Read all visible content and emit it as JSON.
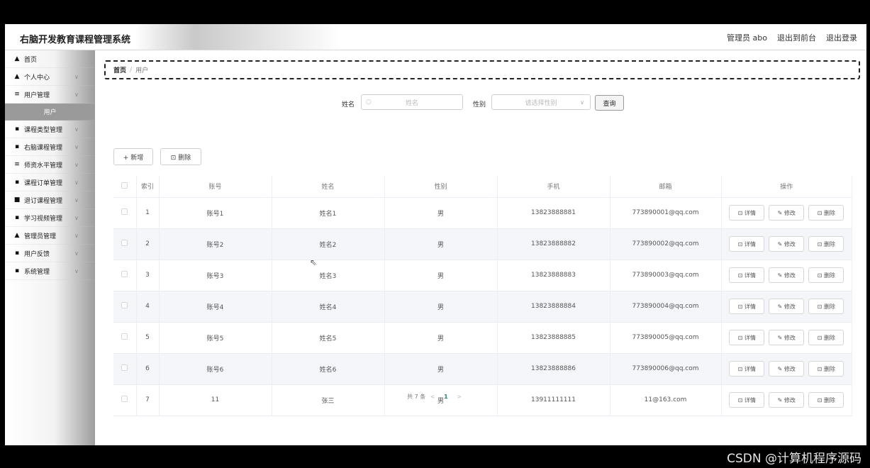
{
  "app": {
    "title": "右脑开发教育课程管理系统",
    "user_label": "管理员 abo",
    "to_front": "退出到前台",
    "logout": "退出登录"
  },
  "sidebar": {
    "items": [
      {
        "icon": "home-icon",
        "glyph": "▲",
        "label": "首页",
        "chevron": false
      },
      {
        "icon": "user-icon",
        "glyph": "▲",
        "label": "个人中心",
        "chevron": true
      },
      {
        "icon": "list-icon",
        "glyph": "≡",
        "label": "用户管理",
        "chevron": true
      },
      {
        "icon": "",
        "glyph": "",
        "label": "用户",
        "chevron": false,
        "sub": true
      },
      {
        "icon": "grid-icon",
        "glyph": "▪",
        "label": "课程类型管理",
        "chevron": true
      },
      {
        "icon": "grid-icon",
        "glyph": "▪",
        "label": "右脑课程管理",
        "chevron": true
      },
      {
        "icon": "sliders-icon",
        "glyph": "≡",
        "label": "师资水平管理",
        "chevron": true
      },
      {
        "icon": "grid-icon",
        "glyph": "▪",
        "label": "课程订单管理",
        "chevron": true
      },
      {
        "icon": "trash-icon",
        "glyph": "■",
        "label": "退订课程管理",
        "chevron": true
      },
      {
        "icon": "grid-icon",
        "glyph": "▪",
        "label": "学习视频管理",
        "chevron": true
      },
      {
        "icon": "admin-icon",
        "glyph": "▲",
        "label": "管理员管理",
        "chevron": true
      },
      {
        "icon": "grid-icon",
        "glyph": "▪",
        "label": "用户反馈",
        "chevron": true
      },
      {
        "icon": "grid-icon",
        "glyph": "▪",
        "label": "系统管理",
        "chevron": true
      }
    ]
  },
  "breadcrumb": {
    "home": "首页",
    "sep": "/",
    "current": "用户"
  },
  "search": {
    "name_label": "姓名",
    "name_placeholder": "姓名",
    "gender_label": "性别",
    "gender_placeholder": "请选择性别",
    "query_button": "查询"
  },
  "actions": {
    "add": "+ 新增",
    "delete": "⊡ 删除"
  },
  "table": {
    "headers": [
      "索引",
      "账号",
      "姓名",
      "性别",
      "手机",
      "邮箱",
      "操作"
    ],
    "rows": [
      {
        "idx": "1",
        "account": "账号1",
        "name": "姓名1",
        "gender": "男",
        "phone": "13823888881",
        "email": "773890001@qq.com"
      },
      {
        "idx": "2",
        "account": "账号2",
        "name": "姓名2",
        "gender": "男",
        "phone": "13823888882",
        "email": "773890002@qq.com"
      },
      {
        "idx": "3",
        "account": "账号3",
        "name": "姓名3",
        "gender": "男",
        "phone": "13823888883",
        "email": "773890003@qq.com"
      },
      {
        "idx": "4",
        "account": "账号4",
        "name": "姓名4",
        "gender": "男",
        "phone": "13823888884",
        "email": "773890004@qq.com"
      },
      {
        "idx": "5",
        "account": "账号5",
        "name": "姓名5",
        "gender": "男",
        "phone": "13823888885",
        "email": "773890005@qq.com"
      },
      {
        "idx": "6",
        "account": "账号6",
        "name": "姓名6",
        "gender": "男",
        "phone": "13823888886",
        "email": "773890006@qq.com"
      },
      {
        "idx": "7",
        "account": "11",
        "name": "张三",
        "gender": "男",
        "phone": "13911111111",
        "email": "11@163.com"
      }
    ],
    "row_ops": {
      "detail": "⊡ 详情",
      "edit": "✎ 修改",
      "delete": "⊡ 删除"
    }
  },
  "pager": {
    "total": "共 7 条",
    "prev": "<",
    "page": "1",
    "next": ">"
  },
  "watermark": "CSDN @计算机程序源码"
}
